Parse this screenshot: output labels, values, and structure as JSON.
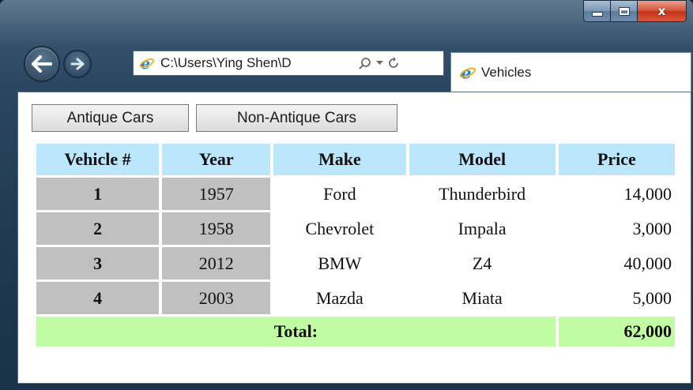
{
  "window": {
    "controls": {
      "minimize_icon": "minimize-icon",
      "maximize_icon": "maximize-icon",
      "close_glyph": "x"
    }
  },
  "nav": {
    "back_icon": "arrow-left-icon",
    "forward_icon": "arrow-right-icon"
  },
  "address_bar": {
    "value": "C:\\Users\\Ying Shen\\D",
    "icons": [
      "ie-logo-icon",
      "search-icon",
      "dropdown-icon",
      "refresh-icon"
    ]
  },
  "tab": {
    "title": "Vehicles",
    "icon": "ie-logo-icon"
  },
  "buttons": {
    "antique": "Antique Cars",
    "non_antique": "Non-Antique Cars"
  },
  "table": {
    "headers": [
      "Vehicle #",
      "Year",
      "Make",
      "Model",
      "Price"
    ],
    "rows": [
      {
        "num": "1",
        "year": "1957",
        "make": "Ford",
        "model": "Thunderbird",
        "price": "14,000"
      },
      {
        "num": "2",
        "year": "1958",
        "make": "Chevrolet",
        "model": "Impala",
        "price": "3,000"
      },
      {
        "num": "3",
        "year": "2012",
        "make": "BMW",
        "model": "Z4",
        "price": "40,000"
      },
      {
        "num": "4",
        "year": "2003",
        "make": "Mazda",
        "model": "Miata",
        "price": "5,000"
      }
    ],
    "total_label": "Total:",
    "total_value": "62,000"
  },
  "colors": {
    "header_bg": "#bce6fb",
    "id_cell_bg": "#c0c0c0",
    "total_bg": "#c1fca4",
    "close_button": "#c83a1f"
  }
}
